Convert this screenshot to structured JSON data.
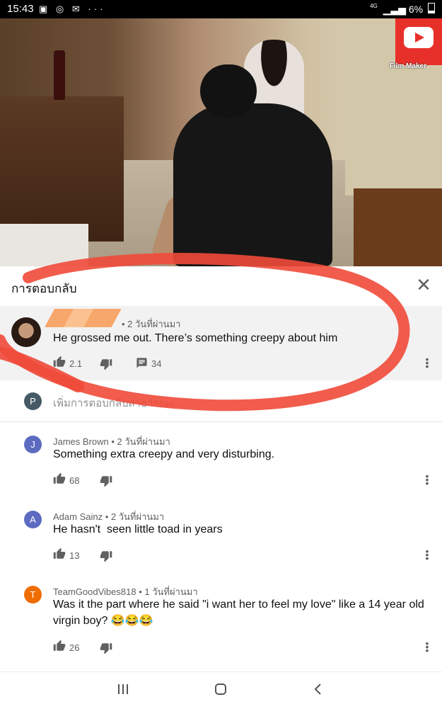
{
  "status_bar": {
    "time": "15:43",
    "notif_icons": [
      "image-icon",
      "chat-icon",
      "mail-icon",
      "more-icon"
    ],
    "network": "4G",
    "battery": "6%"
  },
  "video": {
    "badge_text": "Film Maker",
    "badge_icon": "youtube-play-icon"
  },
  "panel": {
    "title": "การตอบกลับ",
    "close_icon": "close-icon"
  },
  "highlighted_comment": {
    "time_ago": "• 2 วันที่ผ่านมา",
    "text": "He grossed me out. There’s something creepy about him",
    "likes": "2.1",
    "replies": "34"
  },
  "reply_box": {
    "avatar_letter": "P",
    "placeholder": "เพิ่มการตอบกลับสาธารณะ..."
  },
  "comments": [
    {
      "avatar_letter": "J",
      "avatar_color": "#5c6bc0",
      "author": "James Brown",
      "time_ago": "• 2 วันที่ผ่านมา",
      "text": "Something extra creepy and very disturbing.",
      "likes": "68"
    },
    {
      "avatar_letter": "A",
      "avatar_color": "#5c6bc0",
      "author": "Adam Sainz",
      "time_ago": "• 2 วันที่ผ่านมา",
      "text": "He hasn't  seen little toad in years",
      "likes": "13"
    },
    {
      "avatar_letter": "T",
      "avatar_color": "#ef6c00",
      "author": "TeamGoodVibes818",
      "time_ago": "• 1 วันที่ผ่านมา",
      "text": "Was it the part where he said \"i want her to feel my love\" like a 14 year old virgin boy? 😂😂😂",
      "likes": "26"
    }
  ],
  "nav_bar": {
    "recent_icon": "recent-apps-icon",
    "home_icon": "home-icon",
    "back_icon": "back-icon"
  },
  "colors": {
    "accent_red": "#e8302a",
    "annotation_circle": "#f04a3a",
    "reply_avatar": "#455a64"
  }
}
